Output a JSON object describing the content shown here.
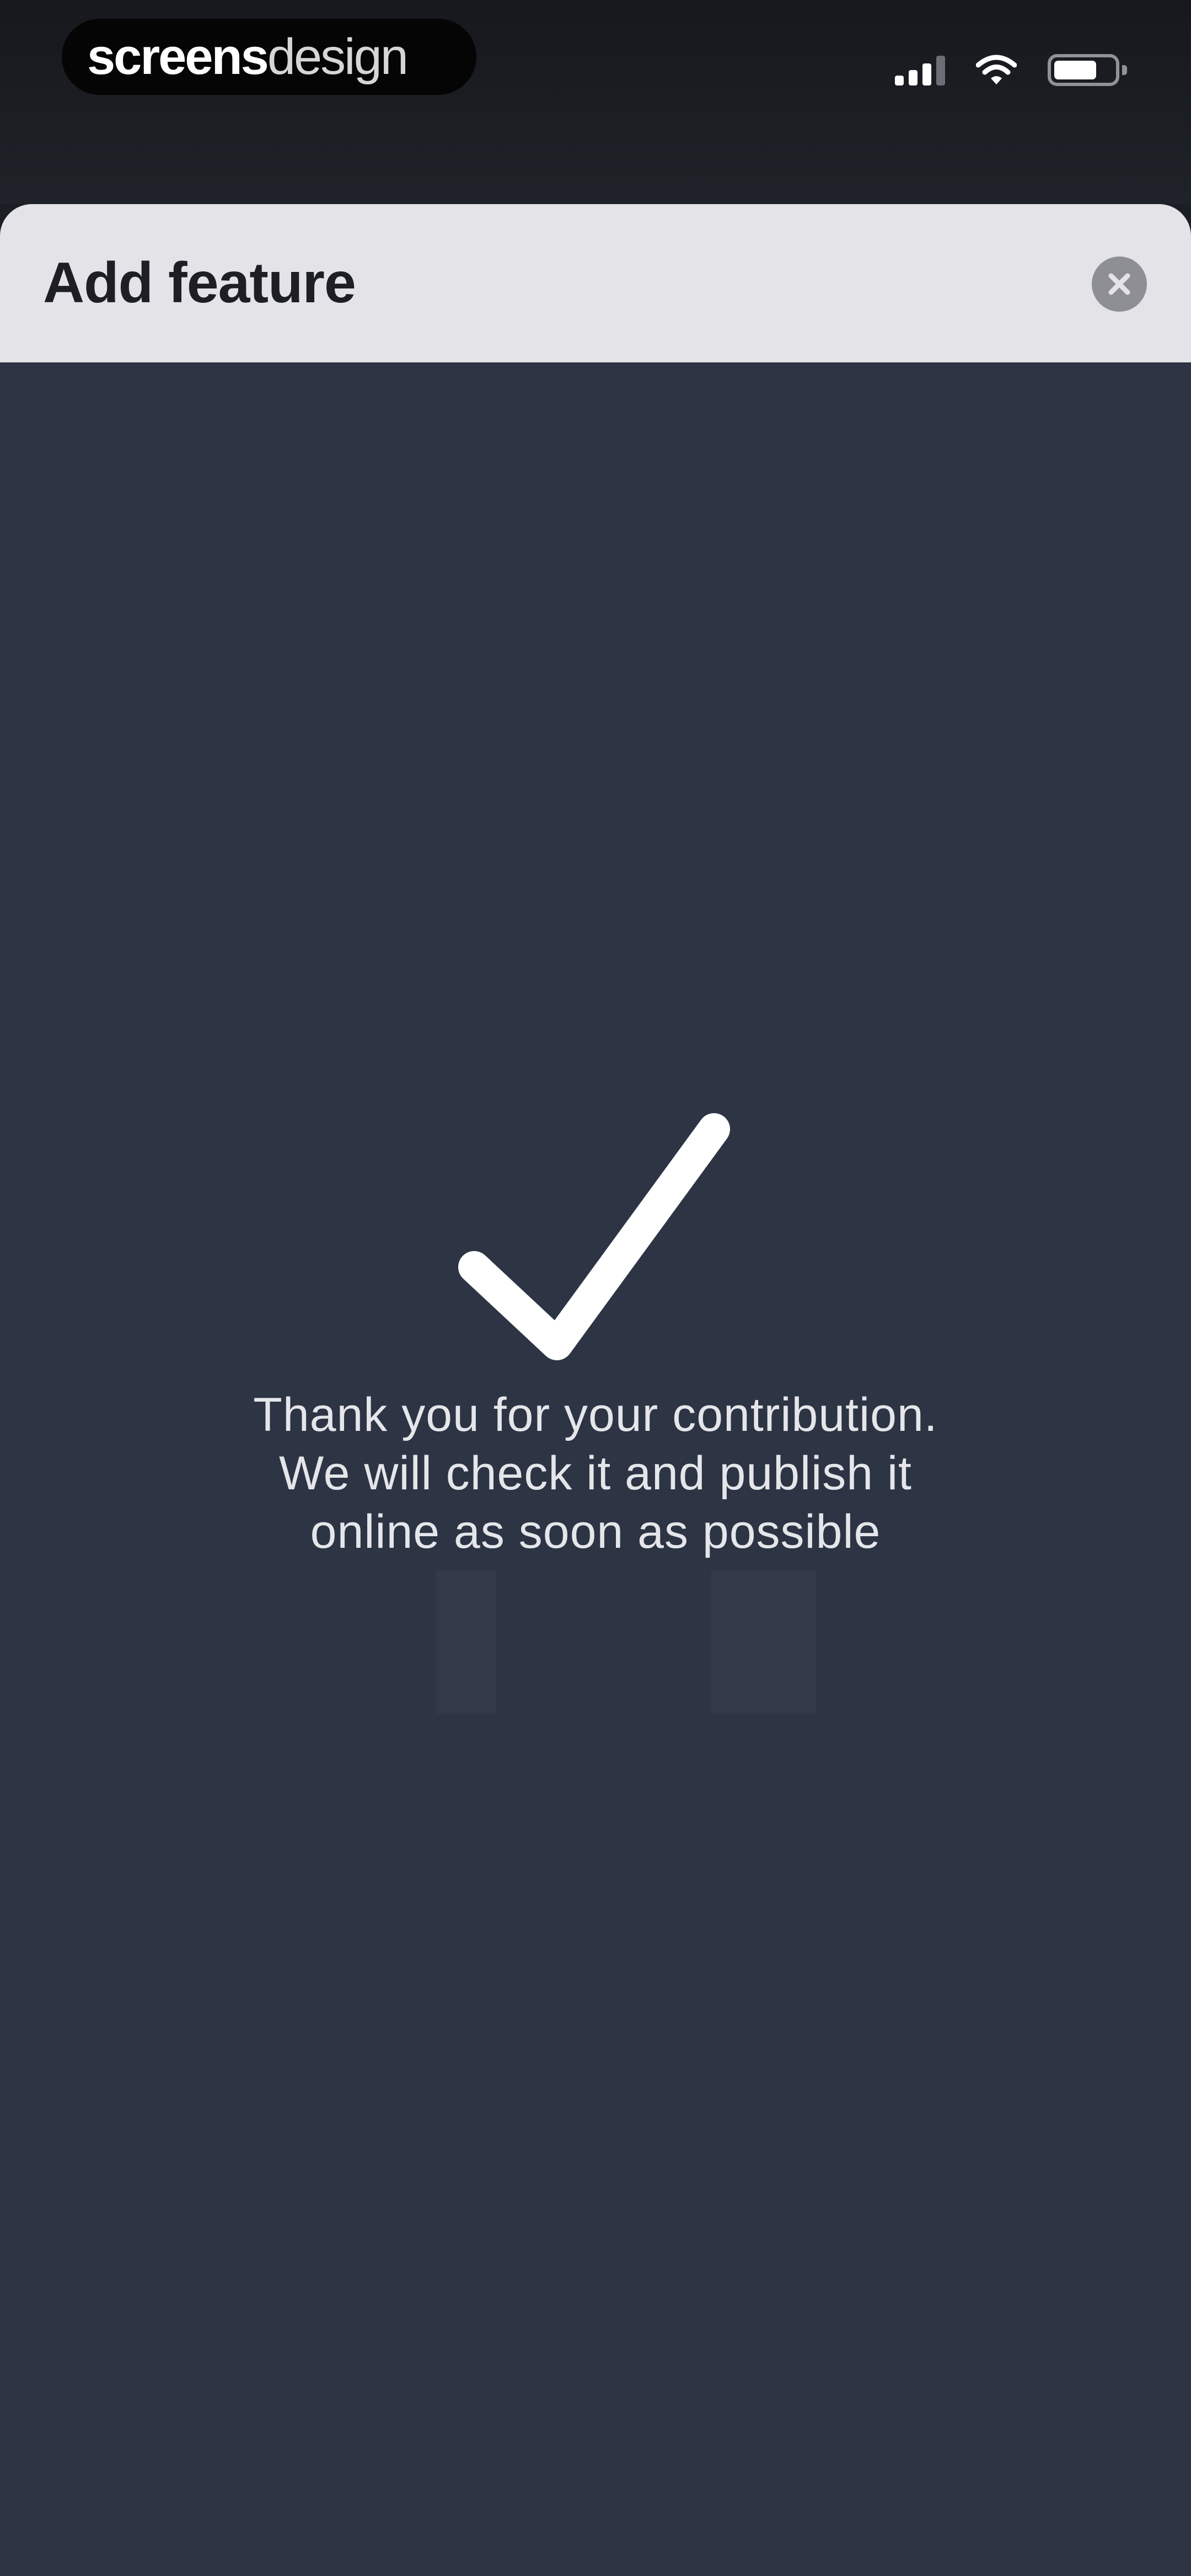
{
  "status_bar": {
    "brand_bold": "screens",
    "brand_light": "design",
    "signal_icon": "signal-icon",
    "wifi_icon": "wifi-icon",
    "battery_icon": "battery-icon"
  },
  "sheet": {
    "title": "Add feature",
    "close_icon": "close-icon"
  },
  "confirmation": {
    "icon": "checkmark-icon",
    "line1": "Thank you for your contribution.",
    "line2": "We will check it and publish it",
    "line3": "online as soon as possible"
  },
  "colors": {
    "background": "#2d3444",
    "header": "#e3e3e8",
    "status_bar": "#1b1e24",
    "text": "#e4e6ea"
  }
}
